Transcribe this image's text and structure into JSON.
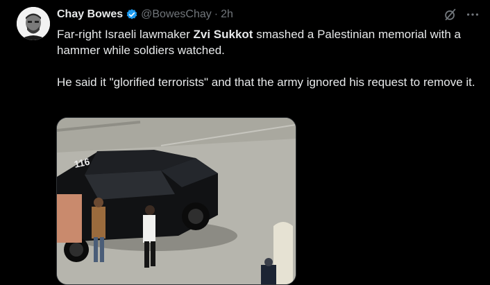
{
  "author": {
    "name": "Chay Bowes",
    "handle": "@BowesChay",
    "time": "2h",
    "separator": "·"
  },
  "icons": {
    "verified": "verified-badge-icon",
    "grok": "grok-icon",
    "more": "more-options-icon"
  },
  "tweet": {
    "p1_before": "Far-right Israeli lawmaker ",
    "p1_bold": "Zvi Sukkot",
    "p1_after": " smashed a Palestinian memorial with a hammer while soldiers watched.",
    "p2": "He said it \"glorified terrorists\" and that the army ignored his request to remove it."
  },
  "media": {
    "vehicle_plate": "116"
  },
  "colors": {
    "background": "#000000",
    "text": "#e7e9ea",
    "secondary_text": "#71767b",
    "verified": "#1d9bf0"
  }
}
